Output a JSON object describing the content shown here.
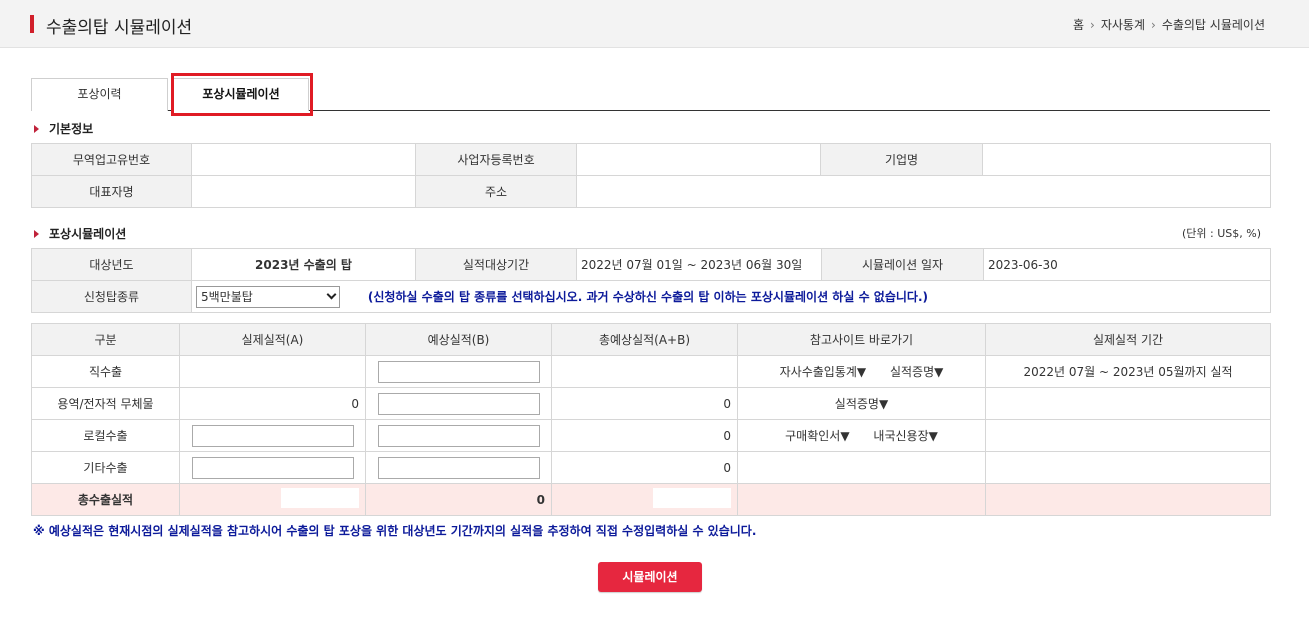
{
  "header": {
    "title": "수출의탑 시뮬레이션",
    "breadcrumb": [
      "홈",
      "자사통계",
      "수출의탑 시뮬레이션"
    ]
  },
  "tabs": [
    {
      "label": "포상이력",
      "active": false
    },
    {
      "label": "포상시뮬레이션",
      "active": true
    }
  ],
  "basic_info": {
    "section_title": "기본정보",
    "labels": {
      "trade_id": "무역업고유번호",
      "business_no": "사업자등록번호",
      "company": "기업명",
      "ceo": "대표자명",
      "address": "주소"
    }
  },
  "simulation": {
    "section_title": "포상시뮬레이션",
    "unit": "(단위 : US$, %)",
    "target_year_label": "대상년도",
    "target_year_value": "2023년 수출의 탑",
    "period_label": "실적대상기간",
    "period_value": "2022년 07월 01일 ~ 2023년 06월 30일",
    "sim_date_label": "시뮬레이션 일자",
    "sim_date_value": "2023-06-30",
    "tower_type_label": "신청탑종류",
    "tower_type_selected": "5백만불탑",
    "notice": "(신청하실 수출의 탑 종류를 선택하십시오. 과거 수상하신 수출의 탑 이하는 포상시뮬레이션 하실 수 없습니다.)"
  },
  "result_table": {
    "headers": [
      "구분",
      "실제실적(A)",
      "예상실적(B)",
      "총예상실적(A+B)",
      "참고사이트 바로가기",
      "실제실적 기간"
    ],
    "rows": [
      {
        "label": "직수출",
        "actual": "",
        "total": "",
        "links": [
          "자사수출입통계▼",
          "실적증명▼"
        ],
        "period": "2022년 07월 ~ 2023년 05월까지 실적"
      },
      {
        "label": "용역/전자적 무체물",
        "actual": "0",
        "total": "0",
        "links": [
          "실적증명▼"
        ],
        "period": ""
      },
      {
        "label": "로컬수출",
        "actual": "",
        "total": "0",
        "links": [
          "구매확인서▼",
          "내국신용장▼"
        ],
        "period": ""
      },
      {
        "label": "기타수출",
        "actual": "",
        "total": "0",
        "links": [],
        "period": ""
      }
    ],
    "total_row": {
      "label": "총수출실적",
      "expected": "0"
    }
  },
  "footnote": "※ 예상실적은 현재시점의 실제실적을 참고하시어 수출의 탑 포상을 위한 대상년도 기간까지의 실적을 추정하여 직접 수정입력하실 수 있습니다.",
  "simulate_button": "시뮬레이션",
  "colors": {
    "accent": "#d11f2a",
    "button": "#e6273f",
    "notice": "#0c1a9a",
    "total_row_bg": "#fde9e7"
  }
}
